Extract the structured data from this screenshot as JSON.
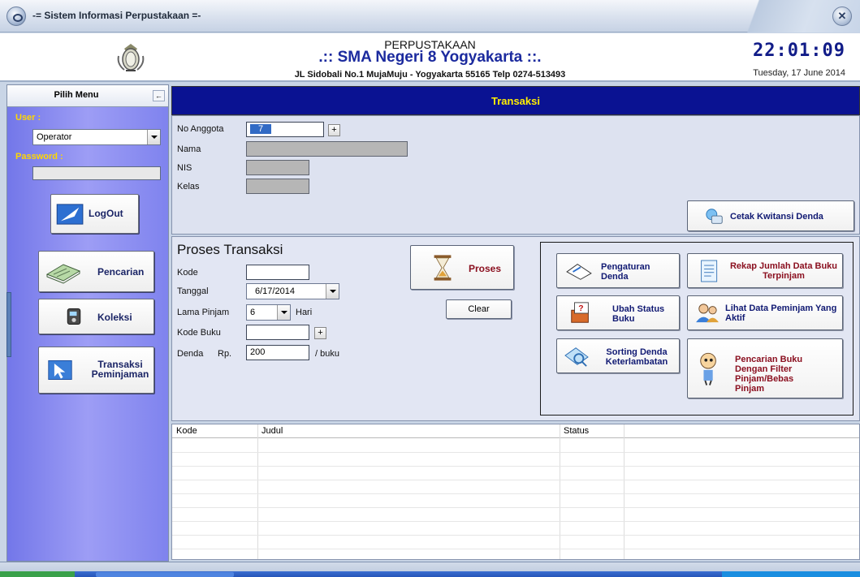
{
  "window": {
    "title": "-= Sistem Informasi Perpustakaan =-"
  },
  "header": {
    "line1": "PERPUSTAKAAN",
    "line2": ".:: SMA Negeri 8 Yogyakarta ::.",
    "line3": "JL Sidobali No.1 MujaMuju - Yogyakarta 55165 Telp 0274-513493",
    "clock": "22:01:09",
    "date": "Tuesday, 17 June 2014"
  },
  "sidebar": {
    "title": "Pilih Menu",
    "pin_symbol": "←",
    "user_label": "User :",
    "user_value": "Operator",
    "password_label": "Password :",
    "logout_label": "LogOut",
    "menu": [
      {
        "label": "Pencarian",
        "icon": "book-search-icon"
      },
      {
        "label": "Koleksi",
        "icon": "collection-icon"
      },
      {
        "label": "Transaksi Peminjaman",
        "icon": "cursor-icon"
      }
    ]
  },
  "main": {
    "title": "Transaksi",
    "member": {
      "no_anggota_label": "No Anggota",
      "no_anggota_value": "7",
      "nama_label": "Nama",
      "nis_label": "NIS",
      "kelas_label": "Kelas",
      "cetak_label": "Cetak Kwitansi Denda"
    },
    "proses": {
      "title": "Proses Transaksi",
      "kode_label": "Kode",
      "tanggal_label": "Tanggal",
      "tanggal_value": "6/17/2014",
      "lama_label": "Lama Pinjam",
      "lama_value": "6",
      "hari_label": "Hari",
      "kode_buku_label": "Kode Buku",
      "denda_label": "Denda",
      "rp_label": "Rp.",
      "denda_value": "200",
      "per_buku": "/ buku",
      "proses_button": "Proses",
      "clear_button": "Clear"
    },
    "tools": {
      "pengaturan": "Pengaturan Denda",
      "rekap": "Rekap Jumlah Data Buku Terpinjam",
      "ubah_status": "Ubah Status Buku",
      "lihat": "Lihat Data Peminjam Yang Aktif",
      "sorting": "Sorting Denda Keterlambatan",
      "pencarian": "Pencarian Buku Dengan Filter Pinjam/Bebas Pinjam"
    },
    "grid": {
      "columns": [
        "Kode",
        "Judul",
        "Status"
      ]
    }
  },
  "colors": {
    "header_navy": "#0a1292",
    "header_text": "#ffee00",
    "sidebar_purple": "#8588f0",
    "sidebar_label": "#ffd700",
    "title_blue": "#1b2a9e"
  }
}
